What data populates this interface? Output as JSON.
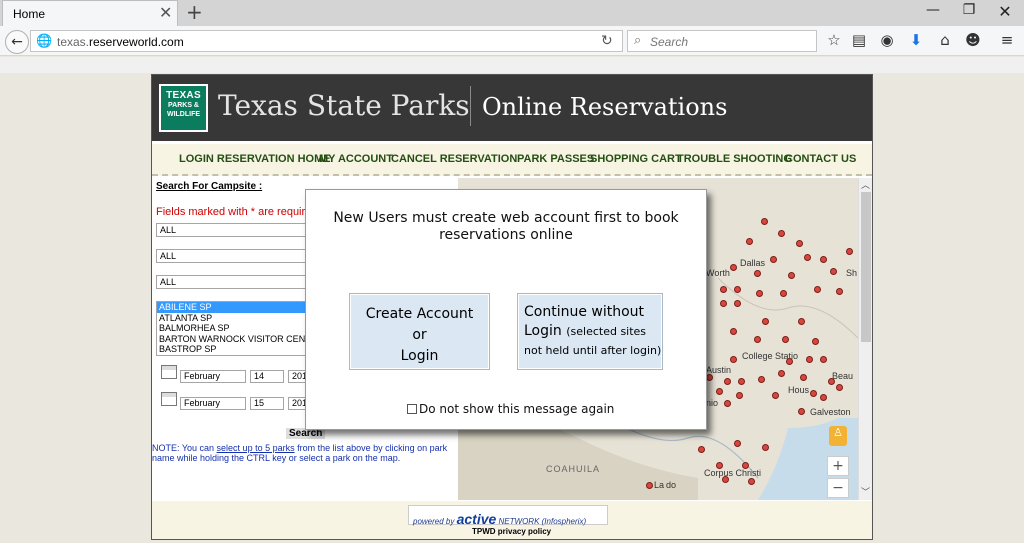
{
  "browser": {
    "tab_title": "Home",
    "url_prefix": "texas.",
    "url_domain": "reserveworld.com",
    "search_placeholder": "Search"
  },
  "header": {
    "logo_line1": "TEXAS",
    "logo_line2": "PARKS &",
    "logo_line3": "WILDLIFE",
    "site_name": "Texas State Parks",
    "subtitle": "Online Reservations"
  },
  "nav": [
    "LOGIN RESERVATION HOME",
    "MY ACCOUNT",
    "CANCEL RESERVATION",
    "PARK PASSES",
    "SHOPPING CART",
    "TROUBLE SHOOTING",
    "CONTACT US"
  ],
  "form": {
    "heading": "Search For Campsite :",
    "required_note": "Fields marked with * are required",
    "select1": "ALL",
    "select2": "ALL",
    "select3": "ALL",
    "parks": [
      "ABILENE SP",
      "ATLANTA SP",
      "BALMORHEA SP",
      "BARTON WARNOCK VISITOR CENTE",
      "BASTROP SP"
    ],
    "arrive_month": "February",
    "arrive_day": "14",
    "arrive_year": "201",
    "depart_month": "February",
    "depart_day": "15",
    "depart_year": "201",
    "search_button": "Search",
    "note_prefix": "NOTE: You can ",
    "note_link": "select up to 5 parks",
    "note_suffix": " from the list above by clicking on park name while holding the CTRL key or select a park on the map."
  },
  "map": {
    "labels": [
      "Dallas",
      "Worth",
      "Sh",
      "Austin",
      "College Statio",
      "Hous",
      "Beau",
      "nio",
      "Galveston",
      "COAHUILA",
      "Corpus Christi",
      "La",
      "do"
    ],
    "zoom_in": "+",
    "zoom_out": "−"
  },
  "footer": {
    "powered_prefix": "powered by",
    "powered_brand": "active",
    "powered_suffix": "NETWORK (Infospherix)",
    "privacy": "TPWD privacy policy"
  },
  "modal": {
    "message": "New Users must create web account first to book reservations online",
    "create_line1": "Create Account",
    "create_line2": "or",
    "create_line3": "Login",
    "continue_line1": "Continue without",
    "continue_line2a": "Login ",
    "continue_line2b": "(selected sites",
    "continue_line3": "not held until after login)",
    "dont_show": "Do not show this message again"
  }
}
